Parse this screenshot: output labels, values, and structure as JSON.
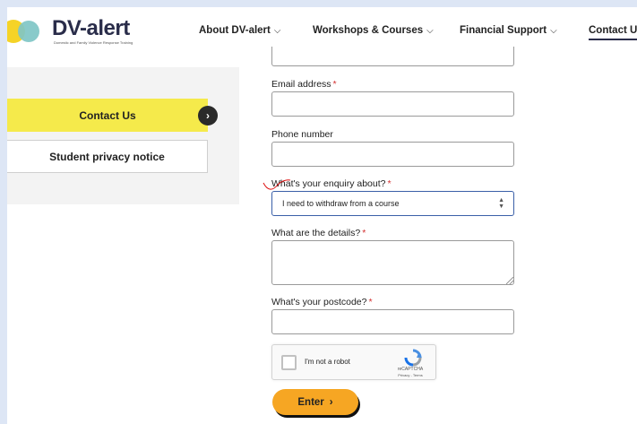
{
  "header": {
    "logo_text": "DV-alert",
    "logo_tagline": "Domestic and Family Violence Response Training",
    "nav": [
      {
        "label": "About DV-alert",
        "chevron": "⌵"
      },
      {
        "label": "Workshops & Courses",
        "chevron": "⌵"
      },
      {
        "label": "Financial Support",
        "chevron": "⌵"
      },
      {
        "label": "Contact Us"
      }
    ]
  },
  "sidebar": {
    "items": [
      {
        "label": "Contact Us",
        "arrow": "›"
      },
      {
        "label": "Student privacy notice"
      }
    ]
  },
  "form": {
    "email_label": "Email address",
    "phone_label": "Phone number",
    "enquiry_label": "What's your enquiry about?",
    "enquiry_value": "I need to withdraw from a course",
    "details_label": "What are the details?",
    "postcode_label": "What's your postcode?",
    "required_mark": "*",
    "captcha_label": "I'm not a robot",
    "captcha_brand": "reCAPTCHA",
    "captcha_links": "Privacy - Terms",
    "submit_label": "Enter",
    "submit_arrow": "›"
  },
  "colors": {
    "accent_yellow": "#f5ea4b",
    "button_orange": "#f6a623",
    "required_red": "#d32f2f",
    "select_focus": "#3a5fa8",
    "brand_navy": "#2a2d4a"
  }
}
